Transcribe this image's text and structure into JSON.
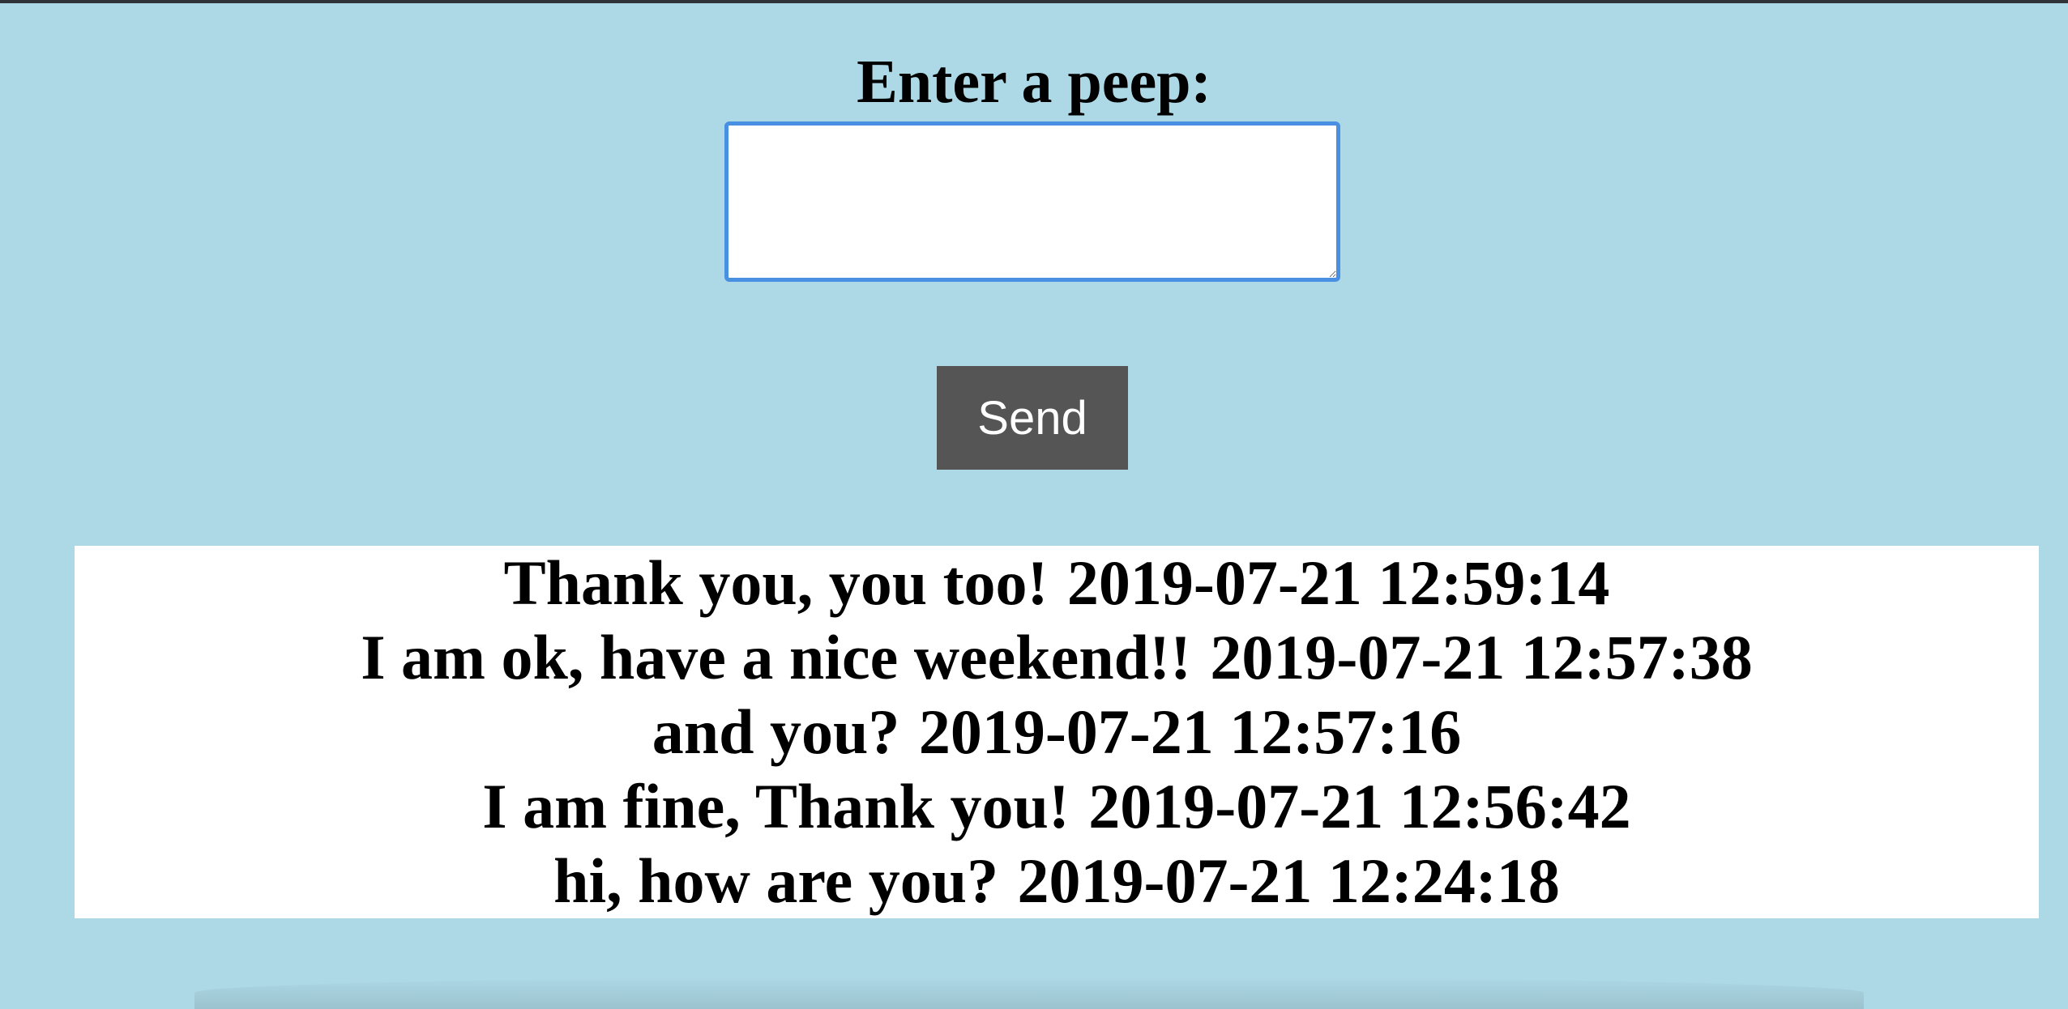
{
  "form": {
    "label": "Enter a peep:",
    "input_value": "",
    "input_placeholder": "",
    "send_label": "Send"
  },
  "peeps": [
    {
      "text": "Thank you, you too!",
      "timestamp": "2019-07-21 12:59:14"
    },
    {
      "text": "I am ok, have a nice weekend!!",
      "timestamp": "2019-07-21 12:57:38"
    },
    {
      "text": "and you?",
      "timestamp": "2019-07-21 12:57:16"
    },
    {
      "text": "I am fine, Thank you!",
      "timestamp": "2019-07-21 12:56:42"
    },
    {
      "text": "hi, how are you?",
      "timestamp": "2019-07-21 12:24:18"
    }
  ],
  "colors": {
    "background": "#add8e6",
    "input_focus_border": "#4a90e2",
    "button": "#555555",
    "feed_background": "#ffffff"
  }
}
